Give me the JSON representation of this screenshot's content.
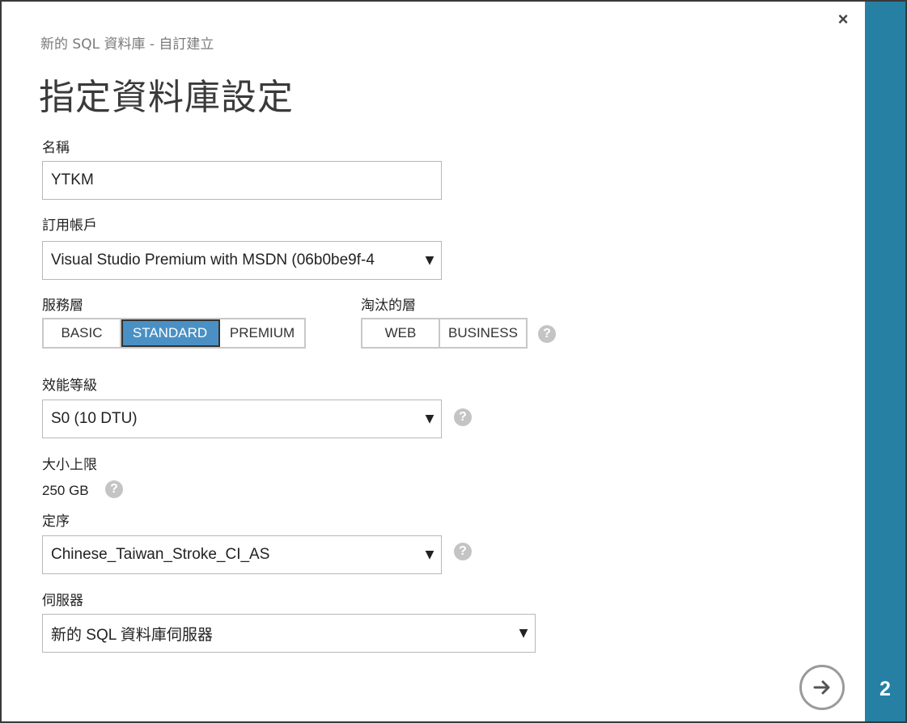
{
  "dialog": {
    "subtitle": "新的 SQL 資料庫 - 自訂建立",
    "title": "指定資料庫設定",
    "close_symbol": "×",
    "step": "2"
  },
  "name": {
    "label": "名稱",
    "value": "YTKM"
  },
  "subscription": {
    "label": "訂用帳戶",
    "value": "Visual Studio Premium with MSDN (06b0be9f-4"
  },
  "service_tier": {
    "label": "服務層",
    "options": [
      "BASIC",
      "STANDARD",
      "PREMIUM"
    ],
    "selected": "STANDARD"
  },
  "retired_tier": {
    "label": "淘汰的層",
    "options": [
      "WEB",
      "BUSINESS"
    ]
  },
  "performance": {
    "label": "效能等級",
    "value": "S0 (10 DTU)"
  },
  "max_size": {
    "label": "大小上限",
    "value": "250 GB"
  },
  "collation": {
    "label": "定序",
    "value": "Chinese_Taiwan_Stroke_CI_AS"
  },
  "server": {
    "label": "伺服器",
    "value": "新的 SQL 資料庫伺服器"
  },
  "icons": {
    "help": "?",
    "dropdown": "▼",
    "next": "arrow-right-icon"
  },
  "colors": {
    "accent": "#2580a4",
    "selected_tab": "#4a90c4",
    "help_icon": "#c4c4c4"
  }
}
